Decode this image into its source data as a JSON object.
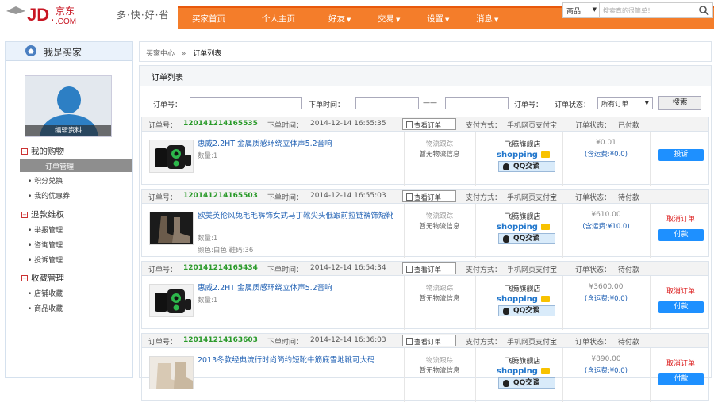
{
  "brand": {
    "logo_text": "JD.京东.COM",
    "slogan": "多·快·好·省"
  },
  "nav": [
    "买家首页",
    "个人主页",
    "好友",
    "交易",
    "设置",
    "消息"
  ],
  "search": {
    "category": "商品",
    "placeholder": "搜索真的很简单！"
  },
  "sidebar": {
    "title": "我是买家",
    "edit_profile": "编辑资料",
    "sections": [
      {
        "label": "我的购物",
        "items": [
          "订单管理",
          "积分兑换",
          "我的优惠券"
        ]
      },
      {
        "label": "退款维权",
        "items": [
          "举报管理",
          "咨询管理",
          "投诉管理"
        ]
      },
      {
        "label": "收藏管理",
        "items": [
          "店铺收藏",
          "商品收藏"
        ]
      }
    ]
  },
  "breadcrumb": {
    "root": "买家中心",
    "sep": "»",
    "current": "订单列表"
  },
  "panel_title": "订单列表",
  "filter": {
    "order_no": "订单号：",
    "time": "下单时间：",
    "range": "——",
    "order_no2": "订单号：",
    "status": "订单状态：",
    "status_value": "所有订单",
    "search": "搜索"
  },
  "labels": {
    "order_no": "订单号：",
    "time": "下单时间：",
    "view": "查看订单",
    "pay": "支付方式：",
    "pay_value": "手机网页支付宝",
    "status": "订单状态：",
    "logistics": "物流跟踪",
    "no_logistics": "暂无物流信息",
    "shop": "飞腾旗舰店",
    "shopping": "shopping",
    "qq": "QQ交谈",
    "cancel": "取消订单"
  },
  "orders": [
    {
      "id": "120141214165535",
      "time": "2014-12-14 16:55:35",
      "status": "已付款",
      "name": "惠威2.2HT 金属质感环绕立体声5.2音响",
      "qty": "数量:1",
      "color": "",
      "price": "¥0.01",
      "freight": "(含运费:¥0.0)",
      "action": "投诉",
      "cancel": false
    },
    {
      "id": "120141214165503",
      "time": "2014-12-14 16:55:03",
      "status": "待付款",
      "name": "欧美英伦风兔毛毛裤饰女式马丁靴尖头低跟前拉链裤饰短靴",
      "qty": "数量:1",
      "color": "颜色:白色 鞋码:36",
      "price": "¥610.00",
      "freight": "(含运费:¥10.0)",
      "action": "付款",
      "cancel": true
    },
    {
      "id": "120141214165434",
      "time": "2014-12-14 16:54:34",
      "status": "待付款",
      "name": "惠威2.2HT 金属质感环绕立体声5.2音响",
      "qty": "数量:1",
      "color": "",
      "price": "¥3600.00",
      "freight": "(含运费:¥0.0)",
      "action": "付款",
      "cancel": true
    },
    {
      "id": "120141214163603",
      "time": "2014-12-14 16:36:03",
      "status": "待付款",
      "name": "2013冬款经典流行时尚简约短靴牛筋底雪地靴可大码",
      "qty": "",
      "color": "",
      "price": "¥890.00",
      "freight": "(含运费:¥0.0)",
      "action": "付款",
      "cancel": true
    }
  ],
  "colors": {
    "nav": "#f47d2a",
    "brand": "#c81623",
    "link": "#2262b4",
    "order_id": "#2a9a2a",
    "button": "#1e90ff",
    "cancel": "#dd2222"
  }
}
